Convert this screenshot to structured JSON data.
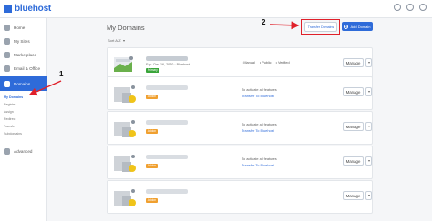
{
  "header": {
    "brand": "bluehost"
  },
  "sidebar": {
    "items": [
      {
        "label": "Home",
        "icon": "home-icon"
      },
      {
        "label": "My Sites",
        "icon": "sites-icon"
      },
      {
        "label": "Marketplace",
        "icon": "marketplace-icon"
      },
      {
        "label": "Email & Office",
        "icon": "email-icon"
      },
      {
        "label": "Domains",
        "icon": "globe-icon"
      }
    ],
    "sub_items": [
      "My Domains",
      "Register",
      "Assign",
      "Redirect",
      "Transfer",
      "Subdomains"
    ],
    "advanced": "Advanced"
  },
  "main": {
    "title": "My Domains",
    "sort_label": "Sort A-Z",
    "transfer_button": "Transfer Domains",
    "add_button": "Add Domain",
    "manage_label": "Manage",
    "rows": [
      {
        "expires": "Exp. Dec 16, 2020 · Bluehost",
        "badge": "Primary",
        "features": [
          "• Manual",
          "• Public",
          "• Verified"
        ]
      },
      {
        "badge": "Addon",
        "activate_text": "To activate all features",
        "activate_link": "Transfer To Bluehost"
      },
      {
        "badge": "Addon",
        "activate_text": "To activate all features",
        "activate_link": "Transfer To Bluehost"
      },
      {
        "badge": "Addon",
        "activate_text": "To activate all features",
        "activate_link": "Transfer To Bluehost"
      },
      {
        "badge": "Addon"
      }
    ]
  },
  "annotations": {
    "step1": "1",
    "step2": "2"
  },
  "colors": {
    "accent": "#2e6bd9",
    "highlight": "#e0202a",
    "primary_badge": "#3aa53a",
    "addon_badge": "#f0a030"
  }
}
